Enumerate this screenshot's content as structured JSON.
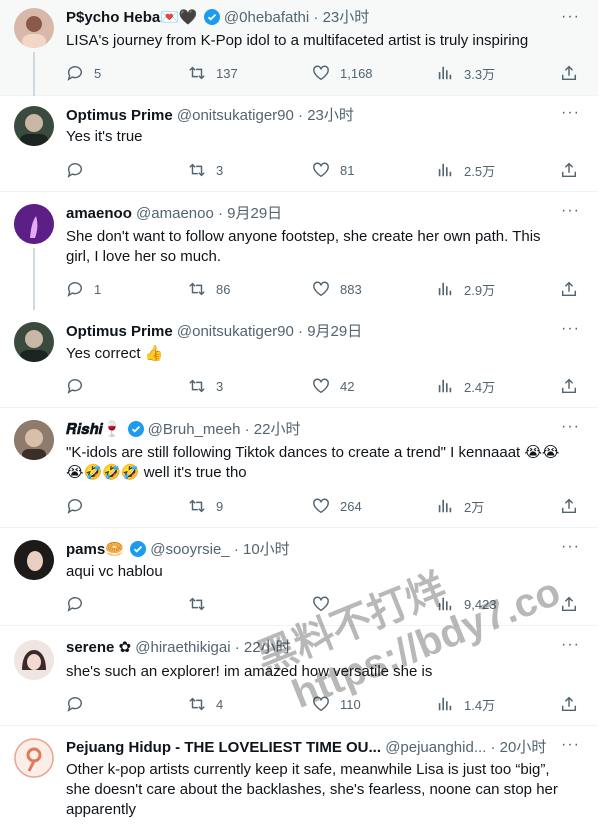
{
  "tweets": [
    {
      "name": "P$ycho Heba",
      "name_emoji": "💌🖤",
      "verified": true,
      "handle": "@0hebafathi",
      "time": "23小时",
      "text": "LISA's journey from K-Pop idol to a multifaceted artist is truly inspiring",
      "replies": "5",
      "retweets": "137",
      "likes": "1,168",
      "views": "3.3万",
      "avatar_color": "#d8b8a8"
    },
    {
      "name": "Optimus Prime",
      "name_emoji": "",
      "verified": false,
      "handle": "@onitsukatiger90",
      "time": "23小时",
      "text": "Yes it's true",
      "replies": "",
      "retweets": "3",
      "likes": "81",
      "views": "2.5万",
      "avatar_color": "#3a4a3e"
    },
    {
      "name": "amaenoo",
      "name_emoji": "",
      "verified": false,
      "handle": "@amaenoo",
      "time": "9月29日",
      "text": "She don't want to follow anyone footstep, she create her own path. This girl, I love her so much.",
      "replies": "1",
      "retweets": "86",
      "likes": "883",
      "views": "2.9万",
      "avatar_color": "#7b2fa0"
    },
    {
      "name": "Optimus Prime",
      "name_emoji": "",
      "verified": false,
      "handle": "@onitsukatiger90",
      "time": "9月29日",
      "text": "Yes correct 👍",
      "replies": "",
      "retweets": "3",
      "likes": "42",
      "views": "2.4万",
      "avatar_color": "#3a4a3e"
    },
    {
      "name": "𝑹𝒊𝒔𝒉𝒊",
      "name_emoji": "🍷",
      "verified": true,
      "handle": "@Bruh_meeh",
      "time": "22小时",
      "text": "\"K-idols are still following Tiktok dances to create a trend\" I kennaaat 😭😭😭🤣🤣🤣 well it's true tho",
      "replies": "",
      "retweets": "9",
      "likes": "264",
      "views": "2万",
      "avatar_color": "#6b5a4e"
    },
    {
      "name": "pams",
      "name_emoji": "🥯",
      "verified": true,
      "handle": "@sooyrsie_",
      "time": "10小时",
      "text": "aqui vc hablou",
      "replies": "",
      "retweets": "",
      "likes": "",
      "views": "9,423",
      "avatar_color": "#2b2422"
    },
    {
      "name": "serene ✿",
      "name_emoji": "",
      "verified": false,
      "handle": "@hiraethikigai",
      "time": "22小时",
      "text": "she's such an explorer! im amazed how versatile she is",
      "replies": "",
      "retweets": "4",
      "likes": "110",
      "views": "1.4万",
      "avatar_color": "#e8dcd8"
    },
    {
      "name": "Pejuang Hidup - THE LOVELIEST TIME OU...",
      "name_emoji": "",
      "verified": false,
      "handle": "@pejuanghid...",
      "time": "20小时",
      "text": "Other k-pop artists currently keep it safe, meanwhile Lisa is just too “big”, she doesn't care about the backlashes, she's fearless, noone can stop her apparently",
      "replies": "",
      "retweets": "",
      "likes": "",
      "views": "",
      "avatar_color": "#f3e6e0"
    }
  ],
  "more_label": "···",
  "watermark": {
    "line1": "黑料不打烊",
    "line2": "https://bdy7.co"
  },
  "colors": {
    "verified": "#1d9bf0",
    "muted": "#536471",
    "thread": "#cfd9de"
  }
}
